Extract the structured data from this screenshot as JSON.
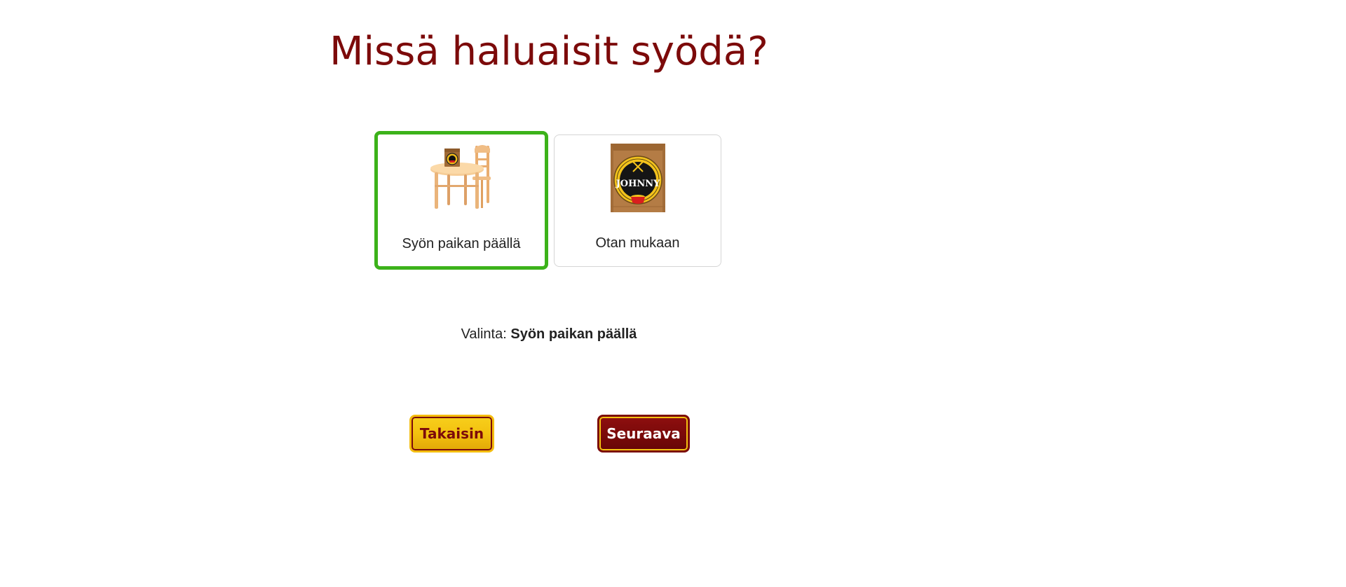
{
  "page": {
    "title": "Missä haluaisit syödä?"
  },
  "options": [
    {
      "label": "Syön paikan päällä",
      "image": "table-and-chair-with-bag",
      "selected": true
    },
    {
      "label": "Otan mukaan",
      "image": "takeaway-paper-bag",
      "selected": false
    }
  ],
  "bag_logo": {
    "text": "JOHNNY"
  },
  "selection": {
    "prefix": "Valinta:",
    "value": "Syön paikan päällä"
  },
  "buttons": {
    "back_label": "Takaisin",
    "next_label": "Seuraava"
  },
  "colors": {
    "title": "#7c0a0a",
    "selected_border": "#3cb21a",
    "back_button": "#f3c10f",
    "next_button": "#7c0a0a"
  }
}
